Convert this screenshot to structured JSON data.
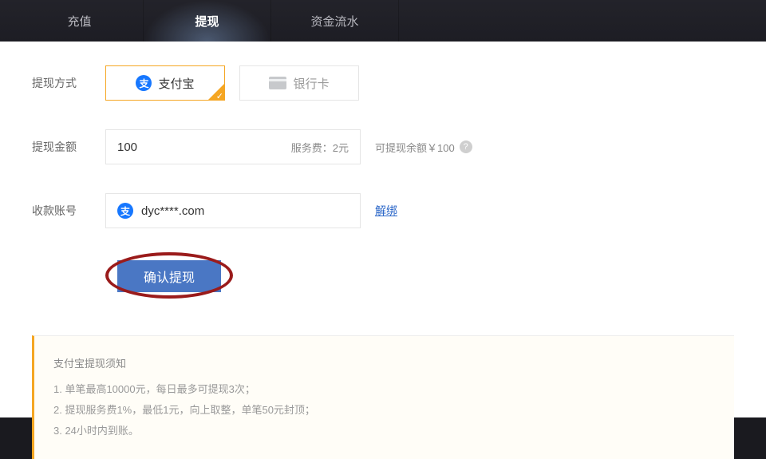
{
  "tabs": {
    "recharge": "充值",
    "withdraw": "提现",
    "flow": "资金流水"
  },
  "labels": {
    "method": "提现方式",
    "amount": "提现金额",
    "account": "收款账号"
  },
  "methods": {
    "alipay": "支付宝",
    "bankcard": "银行卡",
    "alipay_icon_text": "支"
  },
  "amount": {
    "value": "100",
    "fee": "服务费：2元",
    "balance": "可提现余额￥100"
  },
  "account": {
    "value": "dyc****.com",
    "unbind": "解绑"
  },
  "submit": "确认提现",
  "notice": {
    "title": "支付宝提现须知",
    "line1": "1. 单笔最高10000元，每日最多可提现3次；",
    "line2": "2. 提现服务费1%，最低1元，向上取整，单笔50元封顶；",
    "line3": "3. 24小时内到账。"
  }
}
